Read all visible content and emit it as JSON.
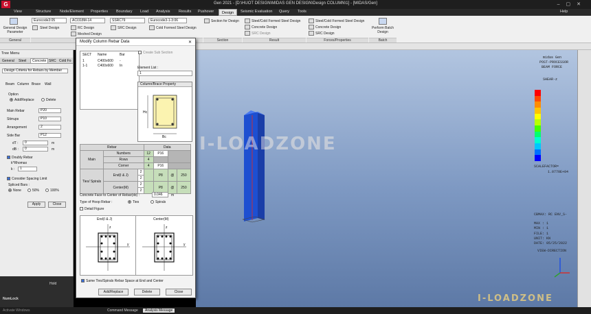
{
  "window": {
    "logo": "G",
    "title": "Gen 2021 - [D:\\HUOT DESIGN\\MIDAS GEN DESIGN\\Design COLUMN\\1] - [MIDAS/Gen]",
    "help": "Help"
  },
  "menu_tabs": [
    "View",
    "Structure",
    "Node/Element",
    "Properties",
    "Boundary",
    "Load",
    "Analysis",
    "Results",
    "Pushover",
    "Design",
    "Seismic Evaluation",
    "Query",
    "Tools"
  ],
  "menu_active": "Design",
  "ribbon": {
    "general_btn": "General Design Parameter",
    "code1": "Eurocode3:05",
    "steel_design": "Steel Design",
    "code2": "ACI318M-14",
    "rc_design": "RC Design",
    "meshed_design": "Meshed Design",
    "code3": "SSRC79",
    "src_design": "SRC Design",
    "code4": "Eurocode3-1-3:06",
    "cold_formed": "Cold Formed Steel Design",
    "section_for_design": "Section for Design",
    "steel_cf_design": "Steel/Cold Formed Steel Design",
    "concrete_design": "Concrete Design",
    "src_design2": "SRC Design",
    "steel_cf_design2": "Steel/Cold Formed Steel Design",
    "concrete_design2": "Concrete Design",
    "src_design3": "SRC Design",
    "perform_batch": "Perform Batch Design",
    "sections": [
      "General",
      "Section",
      "Result",
      "Forces/Properties",
      "Batch"
    ]
  },
  "tree_menu": {
    "title": "Tree Menu",
    "tabs": [
      "General",
      "Steel",
      "Concrete",
      "SRC",
      "Cold Fo"
    ],
    "criteria": "Design Criteria for Rebars by Member",
    "member_tabs": [
      "Beam",
      "Column",
      "Brace",
      "Wall"
    ],
    "option_label": "Option",
    "add_replace": "Add/Replace",
    "delete": "Delete",
    "main_rebar_label": "Main Rebar",
    "main_rebar": "P20",
    "stirrups_label": "Stirrups",
    "stirrups": "P10",
    "arrangement_label": "Arrangement",
    "arrangement": "2",
    "side_bar_label": "Side Bar",
    "side_bar": "P12",
    "dt_label": "dT :",
    "dt": "0",
    "db_label": "dB :",
    "db": "0",
    "unit": "m",
    "doubly_rebar": "Doubly Rebar",
    "k_rhomax_label": "k*Rhomax",
    "k_label": "k :",
    "k": "1",
    "consider_spacing": "Consider Spacing Limit",
    "spliced_bars": "Spliced Bars :",
    "none": "None",
    "fifty": "50%",
    "hundred": "100%",
    "apply": "Apply",
    "close": "Close"
  },
  "dialog": {
    "title": "Modify Column Rebar Data",
    "close_x": "✕",
    "list_headers": [
      "SECT",
      "Name",
      "Bar"
    ],
    "list_rows": [
      {
        "sect": "1",
        "name": "C400x600",
        "bar": "-"
      },
      {
        "sect": "1-1",
        "name": "C400x600",
        "bar": "In"
      }
    ],
    "create_sub_section": "Create Sub Section",
    "element_list_label": "Element List :",
    "element_list": "1",
    "col_prop_title": "Column/Brace Property",
    "rebar_header": "Rebar",
    "data_header": "Data",
    "main_label": "Main",
    "numbers_label": "Numbers",
    "numbers": "12",
    "main_bar": "P16",
    "rows_label": "Rows",
    "rows": "4",
    "corner_label": "Corner",
    "corner": "4",
    "corner_bar": "P16",
    "ties_label": "Ties/ Spirals",
    "end_label": "End(I & J)",
    "end_a": "2",
    "end_b": "2",
    "end_bar": "P8",
    "end_at": "@",
    "end_spacing": "250",
    "center_label": "Center(M)",
    "center_a": "2",
    "center_b": "2",
    "center_bar": "P8",
    "center_at": "@",
    "center_spacing": "250",
    "cover_label": "Concrete Face to Center of Rebar(do) :",
    "cover": "0.046",
    "cover_unit": "m",
    "hoop_label": "Type of Hoop Rebar :",
    "ties": "Ties",
    "spirals": "Spirals",
    "detail_figure": "Detail Figure",
    "fig_end": "End(I & J)",
    "fig_center": "Center(M)",
    "same_ties": "Same Ties/Spirals Rebar Space at End and Center",
    "add_replace": "Add/Replace",
    "delete": "Delete",
    "close": "Close"
  },
  "viewport_legend": {
    "program": "midas Gen",
    "post": "POST-PROCESSOR",
    "type": "BEAM FORCE",
    "comp": "SHEAR-z",
    "scale_label": "SCALEFACTOR=",
    "scale": "1.0770E+04",
    "cbmax": "CBMAX: RC ENV_S-",
    "max": "MAX : 1",
    "min": "MIN : 1",
    "file": "FILE: 1",
    "unit": "UNIT: KN",
    "date": "DATE: 05/25/2022",
    "view_dir": "VIEW-DIRECTION",
    "colors": [
      "#ff0000",
      "#ff4a00",
      "#ff8c00",
      "#ffc400",
      "#ffff00",
      "#b8ff00",
      "#44ff00",
      "#00ff70",
      "#00ffd0",
      "#00c8ff",
      "#0070ff",
      "#0000ff"
    ]
  },
  "watermarks": {
    "center": "I-LOADZONE",
    "corner": "I-LOADZONE"
  },
  "status": {
    "hold": "Hold",
    "numlock": "NumLock",
    "command_tab": "Command Message",
    "analysis_tab": "Analysis Message",
    "windows_hint": "Activate Windows"
  }
}
